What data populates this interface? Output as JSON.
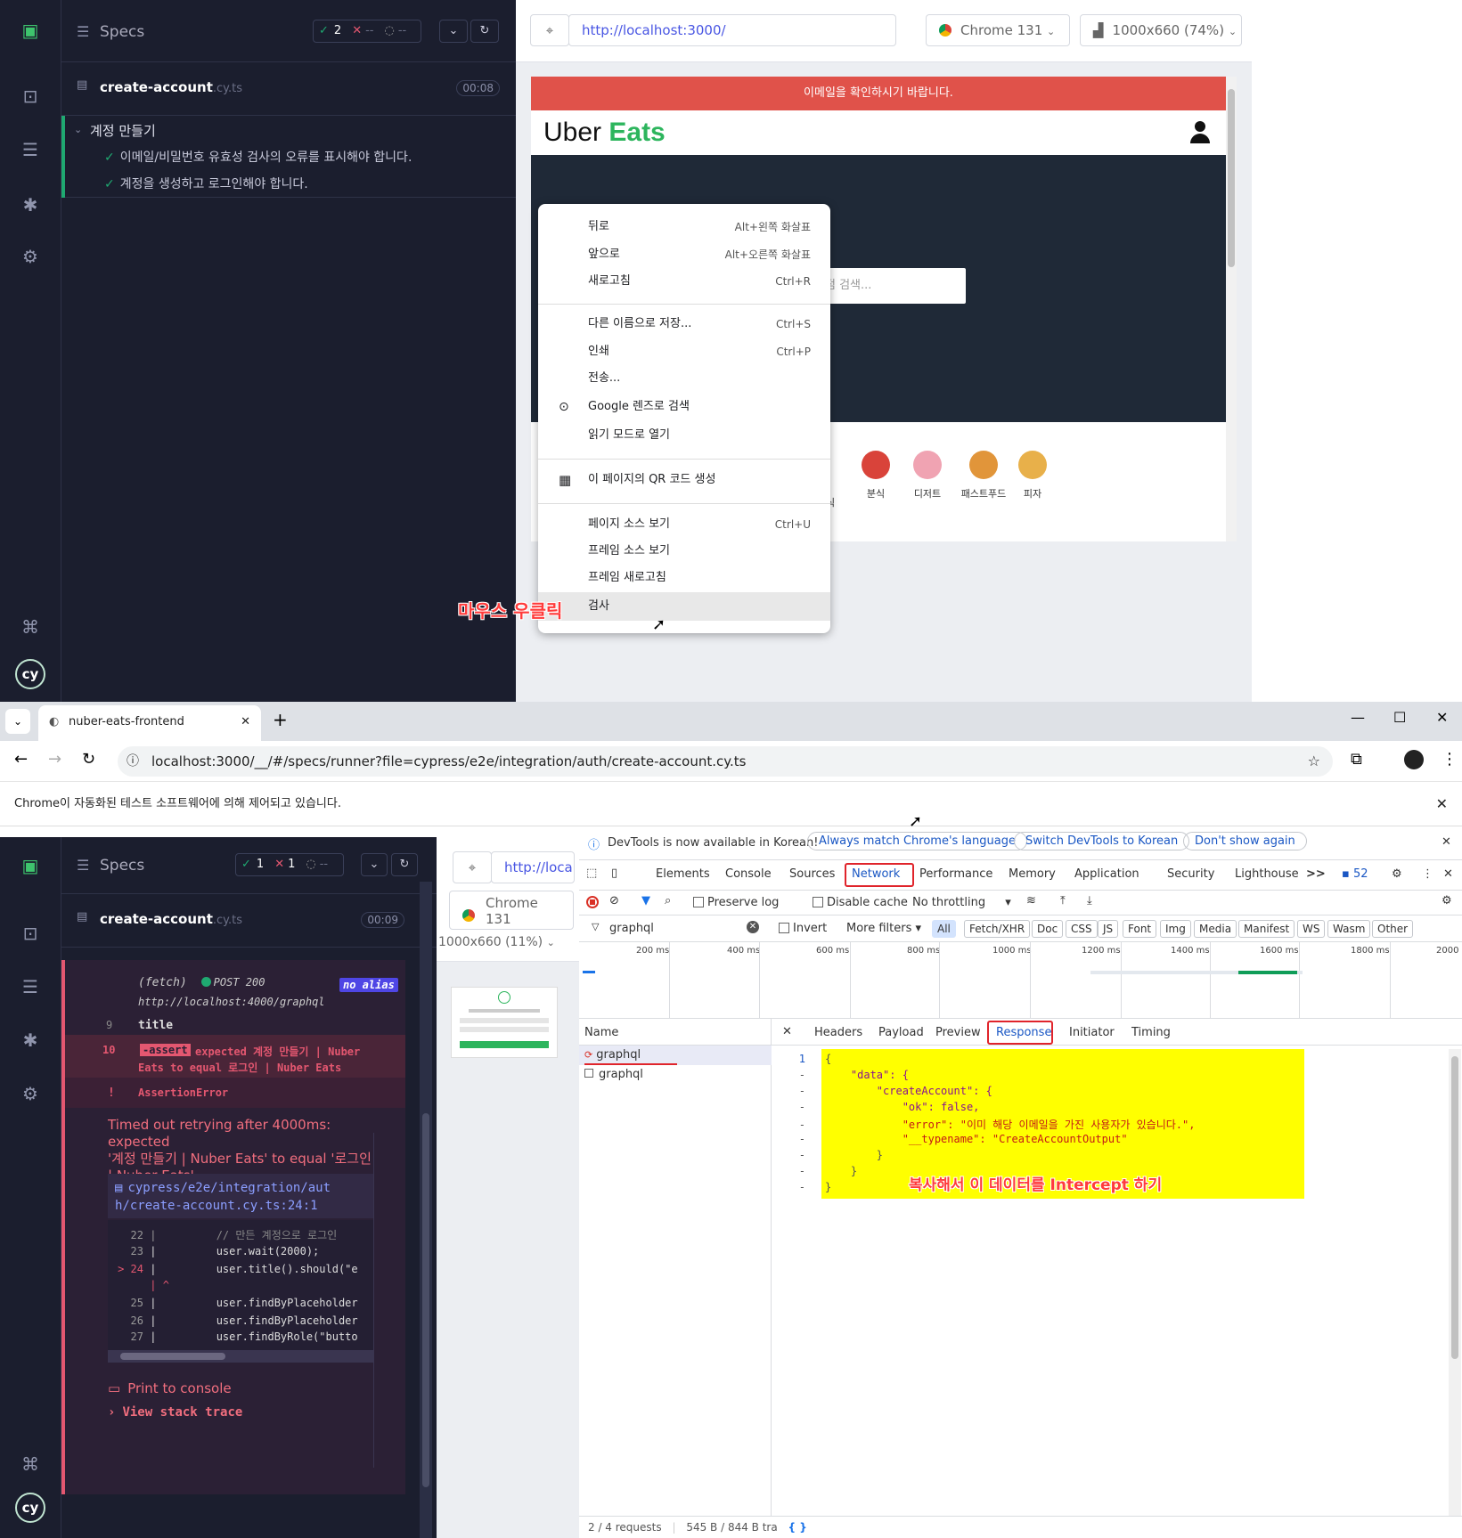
{
  "top": {
    "specs_label": "Specs",
    "pass_count": "2",
    "fail_text": "--",
    "pend_text": "--",
    "spec": {
      "name": "create-account",
      "ext": ".cy.ts",
      "time": "00:08"
    },
    "suite": "계정 만들기",
    "tests": [
      "이메일/비밀번호 유효성 검사의 오류를 표시해야 합니다.",
      "계정을 생성하고 로그인해야 합니다."
    ],
    "url": "http://localhost:3000/",
    "browser": "Chrome 131",
    "viewport": "1000x660 (74%)",
    "aut": {
      "banner": "이메일을 확인하시기 바랍니다.",
      "logo_a": "Uber",
      "logo_b": "Eats",
      "search_placeholder": "점 검색...",
      "categories": [
        "분식",
        "디저트",
        "패스트푸드",
        "피자"
      ],
      "cut_char": "식"
    },
    "context_menu": [
      {
        "label": "뒤로",
        "shortcut": "Alt+왼쪽 화살표"
      },
      {
        "label": "앞으로",
        "shortcut": "Alt+오른쪽 화살표"
      },
      {
        "label": "새로고침",
        "shortcut": "Ctrl+R"
      },
      {
        "label": "다른 이름으로 저장...",
        "shortcut": "Ctrl+S"
      },
      {
        "label": "인쇄",
        "shortcut": "Ctrl+P"
      },
      {
        "label": "전송...",
        "shortcut": ""
      },
      {
        "label": "Google 렌즈로 검색",
        "shortcut": ""
      },
      {
        "label": "읽기 모드로 열기",
        "shortcut": ""
      },
      {
        "label": "이 페이지의 QR 코드 생성",
        "shortcut": ""
      },
      {
        "label": "페이지 소스 보기",
        "shortcut": "Ctrl+U"
      },
      {
        "label": "프레임 소스 보기",
        "shortcut": ""
      },
      {
        "label": "프레임 새로고침",
        "shortcut": ""
      },
      {
        "label": "검사",
        "shortcut": ""
      }
    ],
    "annotation": "마우스 우클릭"
  },
  "chrome": {
    "tab_title": "nuber-eats-frontend",
    "url": "localhost:3000/__/#/specs/runner?file=cypress/e2e/integration/auth/create-account.cy.ts",
    "infobar": "Chrome이 자동화된 테스트 소프트웨어에 의해 제어되고 있습니다."
  },
  "bottom": {
    "specs_label": "Specs",
    "pass_count": "1",
    "fail_count": "1",
    "pend_text": "--",
    "spec": {
      "name": "create-account",
      "ext": ".cy.ts",
      "time": "00:09"
    },
    "fetch_label": "(fetch)",
    "fetch_status": "POST 200",
    "no_alias": "no alias",
    "fetch_url": "http://localhost:4000/graphql",
    "line9_num": "9",
    "line9": "title",
    "line10_num": "10",
    "assert_badge": "-assert",
    "assert_1": "expected 계정 만들기 | Nuber",
    "assert_2": "Eats to equal 로그인 | Nuber Eats",
    "error_bang": "!",
    "error_name": "AssertionError",
    "error_msg_1": "Timed out retrying after 4000ms: expected",
    "error_msg_2": "'계정 만들기 | Nuber Eats' to equal '로그인",
    "error_msg_3": "| Nuber Eats'",
    "file_link_1": "cypress/e2e/integration/aut",
    "file_link_2": "h/create-account.cy.ts:24:1",
    "code": [
      {
        "n": "22",
        "t": "// 만든 계정으로 로그인"
      },
      {
        "n": "23",
        "t": "user.wait(2000);"
      },
      {
        "n": "> 24",
        "t": "user.title().should(\"e"
      },
      {
        "n": "",
        "t": "^"
      },
      {
        "n": "25",
        "t": "user.findByPlaceholder"
      },
      {
        "n": "26",
        "t": "user.findByPlaceholder"
      },
      {
        "n": "27",
        "t": "user.findByRole(\"butto"
      }
    ],
    "print_console": "Print to console",
    "stack_trace": "View stack trace",
    "mini_url": "http://loca",
    "mini_browser_1": "Chrome",
    "mini_browser_2": "131",
    "mini_viewport": "1000x660 (11%)"
  },
  "devtools": {
    "notice": "DevTools is now available in Korean!",
    "btn_match": "Always match Chrome's language",
    "btn_switch": "Switch DevTools to Korean",
    "btn_dont": "Don't show again",
    "tabs": [
      "Elements",
      "Console",
      "Sources",
      "Network",
      "Performance",
      "Memory",
      "Application",
      "Security",
      "Lighthouse"
    ],
    "more_tabs": ">>",
    "issues": "52",
    "preserve_log": "Preserve log",
    "disable_cache": "Disable cache",
    "throttling": "No throttling",
    "filter_value": "graphql",
    "invert": "Invert",
    "more_filters": "More filters",
    "types": [
      "All",
      "Fetch/XHR",
      "Doc",
      "CSS",
      "JS",
      "Font",
      "Img",
      "Media",
      "Manifest",
      "WS",
      "Wasm",
      "Other"
    ],
    "ticks": [
      "200 ms",
      "400 ms",
      "600 ms",
      "800 ms",
      "1000 ms",
      "1200 ms",
      "1400 ms",
      "1600 ms",
      "1800 ms",
      "2000"
    ],
    "name_header": "Name",
    "requests": [
      "graphql",
      "graphql"
    ],
    "detail_tabs": [
      "Headers",
      "Payload",
      "Preview",
      "Response",
      "Initiator",
      "Timing"
    ],
    "response_lines": [
      {
        "n": "1",
        "t": "{"
      },
      {
        "n": "-",
        "t": "    \"data\": {"
      },
      {
        "n": "-",
        "t": "        \"createAccount\": {"
      },
      {
        "n": "-",
        "t": "            \"ok\": false,"
      },
      {
        "n": "-",
        "t": "            \"error\": \"이미 해당 이메일을 가진 사용자가 있습니다.\","
      },
      {
        "n": "-",
        "t": "            \"__typename\": \"CreateAccountOutput\""
      },
      {
        "n": "-",
        "t": "        }"
      },
      {
        "n": "-",
        "t": "    }"
      },
      {
        "n": "-",
        "t": "}"
      }
    ],
    "annotation": "복사해서 이 데이터를 Intercept 하기",
    "status": "2 / 4 requests",
    "transfer": "545 B / 844 B tra",
    "highlight_color": "#ffff00",
    "accent": "#e0242b"
  }
}
